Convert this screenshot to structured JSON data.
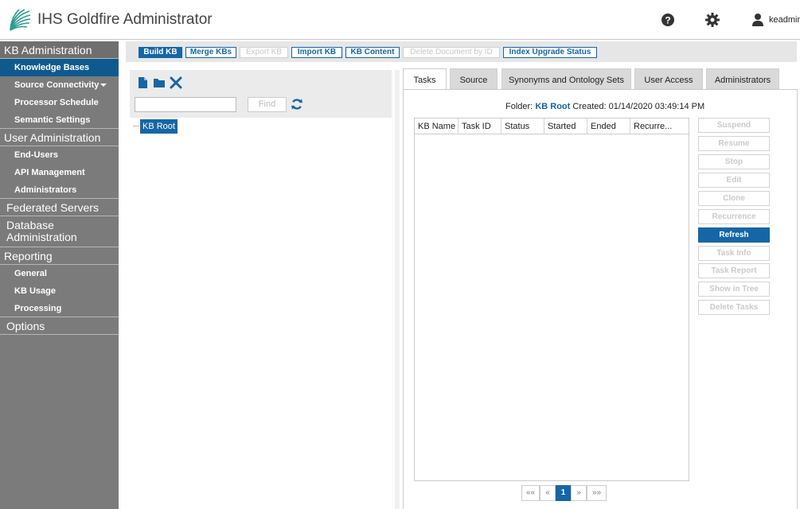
{
  "app": {
    "title": "IHS Goldfire Administrator"
  },
  "header": {
    "user_name": "keadmin"
  },
  "sidebar": {
    "kb_admin": {
      "label": "KB Administration",
      "items": [
        "Knowledge Bases",
        "Source Connectivity",
        "Processor Schedule",
        "Semantic Settings"
      ]
    },
    "user_admin": {
      "label": "User Administration",
      "items": [
        "End-Users",
        "API Management",
        "Administrators"
      ]
    },
    "federated": {
      "label": "Federated Servers"
    },
    "database": {
      "label": "Database Administration"
    },
    "reporting": {
      "label": "Reporting",
      "items": [
        "General",
        "KB Usage",
        "Processing"
      ]
    },
    "options": {
      "label": "Options"
    }
  },
  "toolbar": {
    "buttons": [
      "Build KB",
      "Merge KBs",
      "Export KB",
      "Import KB",
      "KB Content",
      "Delete Document by ID",
      "Index Upgrade Status"
    ]
  },
  "tree": {
    "find_value": "",
    "find_label": "Find",
    "root_node": "KB Root"
  },
  "tabs": [
    "Tasks",
    "Source",
    "Synonyms and Ontology Sets",
    "User Access",
    "Administrators"
  ],
  "tasks": {
    "folder_label": "Folder:",
    "folder_name": "KB Root",
    "created_label": "Created:",
    "created_value": "01/14/2020 03:49:14 PM",
    "columns": [
      "KB Name",
      "Task ID",
      "Status",
      "Started",
      "Ended",
      "Recurre..."
    ],
    "actions": [
      "Suspend",
      "Resume",
      "Stop",
      "Edit",
      "Clone",
      "Recurrence",
      "Refresh",
      "Task Info",
      "Task Report",
      "Show in Tree",
      "Delete Tasks"
    ]
  },
  "pager": {
    "first": "««",
    "prev": "«",
    "current": "1",
    "next": "»",
    "last": "»»"
  },
  "colors": {
    "accent": "#1566a6",
    "sidebar_bg": "#7b7b7b",
    "sidebar_active": "#0e5a8e"
  },
  "icons": [
    "logo-icon",
    "help-icon",
    "gear-icon",
    "user-icon",
    "new-document-icon",
    "folder-icon",
    "delete-icon",
    "refresh-icon"
  ]
}
